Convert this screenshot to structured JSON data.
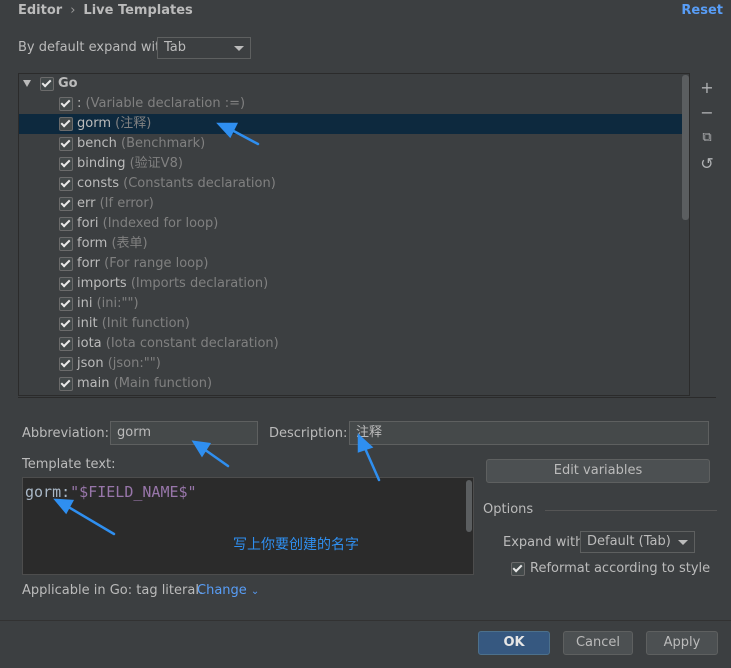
{
  "breadcrumb": {
    "parent": "Editor",
    "separator": "›",
    "current": "Live Templates"
  },
  "reset_label": "Reset",
  "expand": {
    "label": "By default expand with",
    "value": "Tab"
  },
  "tree": {
    "group": "Go",
    "items": [
      {
        "name": ":",
        "desc": "(Variable declaration :=)"
      },
      {
        "name": "gorm",
        "desc": "(注释)"
      },
      {
        "name": "bench",
        "desc": "(Benchmark)"
      },
      {
        "name": "binding",
        "desc": "(验证V8)"
      },
      {
        "name": "consts",
        "desc": "(Constants declaration)"
      },
      {
        "name": "err",
        "desc": "(If error)"
      },
      {
        "name": "fori",
        "desc": "(Indexed for loop)"
      },
      {
        "name": "form",
        "desc": "(表单)"
      },
      {
        "name": "forr",
        "desc": "(For range loop)"
      },
      {
        "name": "imports",
        "desc": "(Imports declaration)"
      },
      {
        "name": "ini",
        "desc": "(ini:\"\")"
      },
      {
        "name": "init",
        "desc": "(Init function)"
      },
      {
        "name": "iota",
        "desc": "(Iota constant declaration)"
      },
      {
        "name": "json",
        "desc": "(json:\"\")"
      },
      {
        "name": "main",
        "desc": "(Main function)"
      }
    ]
  },
  "side_buttons": {
    "add": "+",
    "remove": "−",
    "copy": "⧉",
    "restore": "↺"
  },
  "abbreviation": {
    "label": "Abbreviation:",
    "value": "gorm"
  },
  "description": {
    "label": "Description:",
    "value": "注释"
  },
  "template_text": {
    "label": "Template text:",
    "keyword": "gorm",
    "colon": ":",
    "string": "\"$FIELD_NAME$\""
  },
  "edit_variables": "Edit variables",
  "options": {
    "title": "Options",
    "expand_with_label": "Expand with",
    "expand_with_value": "Default (Tab)",
    "reformat_label": "Reformat according to style"
  },
  "annotation": "写上你要创建的名字",
  "applicable": {
    "text": "Applicable in Go: tag literal.",
    "change": "Change"
  },
  "footer": {
    "ok": "OK",
    "cancel": "Cancel",
    "apply": "Apply"
  },
  "colors": {
    "accent": "#589df6",
    "annotation": "#2f8ff0",
    "selection": "#0d293e"
  }
}
